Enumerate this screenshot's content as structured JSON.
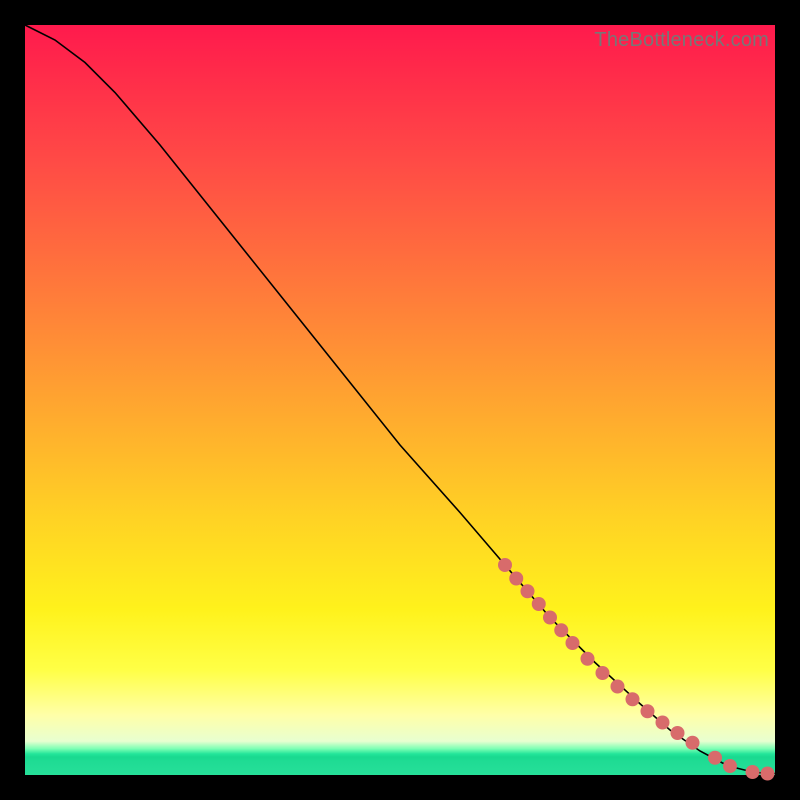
{
  "attribution": "TheBottleneck.com",
  "colors": {
    "marker": "#d86b6b",
    "curve": "#000000",
    "frame": "#000000"
  },
  "chart_data": {
    "type": "line",
    "title": "",
    "xlabel": "",
    "ylabel": "",
    "xlim": [
      0,
      100
    ],
    "ylim": [
      0,
      100
    ],
    "series": [
      {
        "name": "curve",
        "x": [
          0,
          4,
          8,
          12,
          18,
          26,
          34,
          42,
          50,
          58,
          64,
          70,
          76,
          82,
          86,
          90,
          93,
          95,
          97,
          99,
          100
        ],
        "y": [
          100,
          98,
          95,
          91,
          84,
          74,
          64,
          54,
          44,
          35,
          28,
          21,
          15,
          9.5,
          6,
          3.2,
          1.6,
          0.9,
          0.4,
          0.2,
          0.2
        ]
      }
    ],
    "markers": {
      "name": "highlighted-points",
      "x": [
        64,
        65.5,
        67,
        68.5,
        70,
        71.5,
        73,
        75,
        77,
        79,
        81,
        83,
        85,
        87,
        89,
        92,
        94,
        97,
        99
      ],
      "y": [
        28,
        26.2,
        24.5,
        22.8,
        21,
        19.3,
        17.6,
        15.5,
        13.6,
        11.8,
        10.1,
        8.5,
        7,
        5.6,
        4.3,
        2.3,
        1.2,
        0.4,
        0.2
      ],
      "r": 7
    }
  }
}
